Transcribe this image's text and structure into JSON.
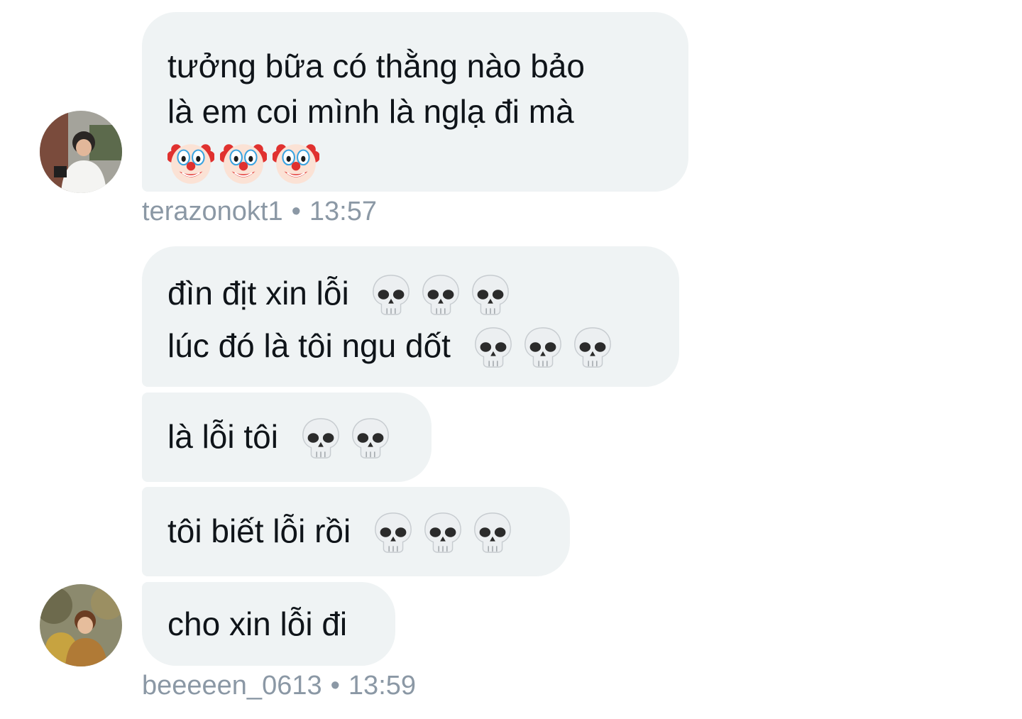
{
  "conversation": {
    "group1": {
      "message1": {
        "line1": "tưởng bữa có thằng nào bảo",
        "line2": "là em coi mình là nglạ đi mà",
        "emoji": "clown-face",
        "emoji_count": 3
      },
      "meta": {
        "username": "terazonokt1",
        "separator": "•",
        "time": "13:57"
      }
    },
    "group2": {
      "message1": {
        "line1": "đìn địt xin lỗi",
        "line2": "lúc đó là tôi ngu dốt",
        "emoji": "skull",
        "emoji_count_line1": 3,
        "emoji_count_line2": 3
      },
      "message2": {
        "text": "là lỗi tôi",
        "emoji": "skull",
        "emoji_count": 2
      },
      "message3": {
        "text": "tôi biết lỗi rồi",
        "emoji": "skull",
        "emoji_count": 3
      },
      "message4": {
        "text": "cho xin lỗi đi"
      },
      "meta": {
        "username": "beeeeen_0613",
        "separator": "•",
        "time": "13:59"
      }
    }
  },
  "colors": {
    "bubble_bg": "#eff3f4",
    "text": "#0f1419",
    "meta_text": "#8b98a5"
  }
}
